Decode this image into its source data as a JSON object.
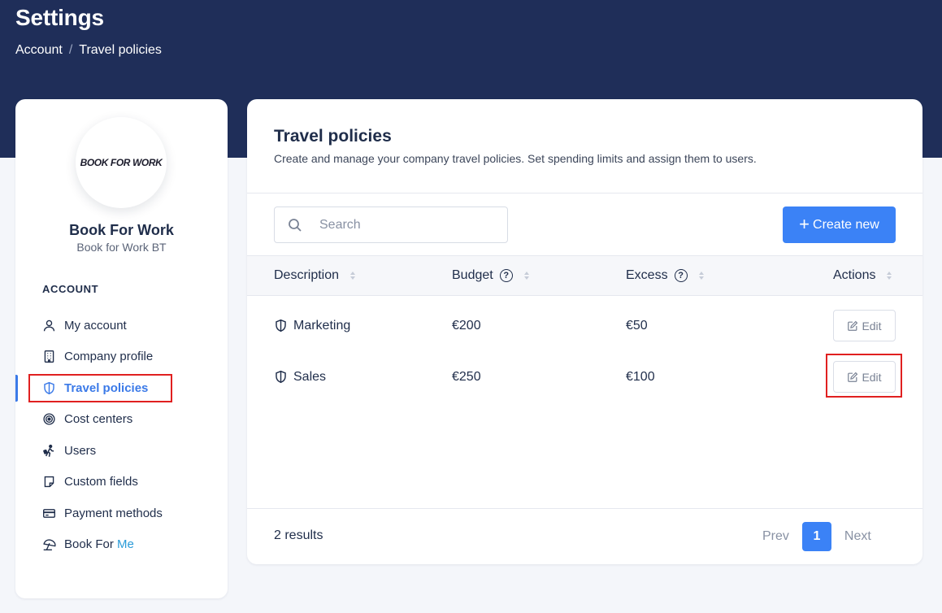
{
  "header": {
    "title": "Settings",
    "breadcrumb": [
      "Account",
      "Travel policies"
    ],
    "separator": "/"
  },
  "sidebar": {
    "logo_text": "BOOK FOR WORK",
    "org_name": "Book For Work",
    "org_subtitle": "Book for Work BT",
    "section_title": "ACCOUNT",
    "items": [
      {
        "label": "My account",
        "icon": "user-icon"
      },
      {
        "label": "Company profile",
        "icon": "building-icon"
      },
      {
        "label": "Travel policies",
        "icon": "shield-icon",
        "active": true
      },
      {
        "label": "Cost centers",
        "icon": "target-icon"
      },
      {
        "label": "Users",
        "icon": "traveler-icon"
      },
      {
        "label": "Custom fields",
        "icon": "note-icon"
      },
      {
        "label": "Payment methods",
        "icon": "credit-card-icon"
      },
      {
        "label": "Book For",
        "label_accent": "Me",
        "icon": "beach-umbrella-icon"
      }
    ]
  },
  "main": {
    "title": "Travel policies",
    "subtitle": "Create and manage your company travel policies. Set spending limits and assign them to users.",
    "search_placeholder": "Search",
    "create_label": "Create new",
    "columns": [
      "Description",
      "Budget",
      "Excess",
      "Actions"
    ],
    "rows": [
      {
        "description": "Marketing",
        "budget": "€200",
        "excess": "€50",
        "action": "Edit"
      },
      {
        "description": "Sales",
        "budget": "€250",
        "excess": "€100",
        "action": "Edit"
      }
    ],
    "results_text": "2 results",
    "pagination": {
      "prev": "Prev",
      "current": "1",
      "next": "Next"
    }
  },
  "colors": {
    "header_bg": "#1f2e59",
    "primary": "#3b82f6",
    "active_nav": "#3b7ae8",
    "highlight_frame": "#e02020"
  }
}
